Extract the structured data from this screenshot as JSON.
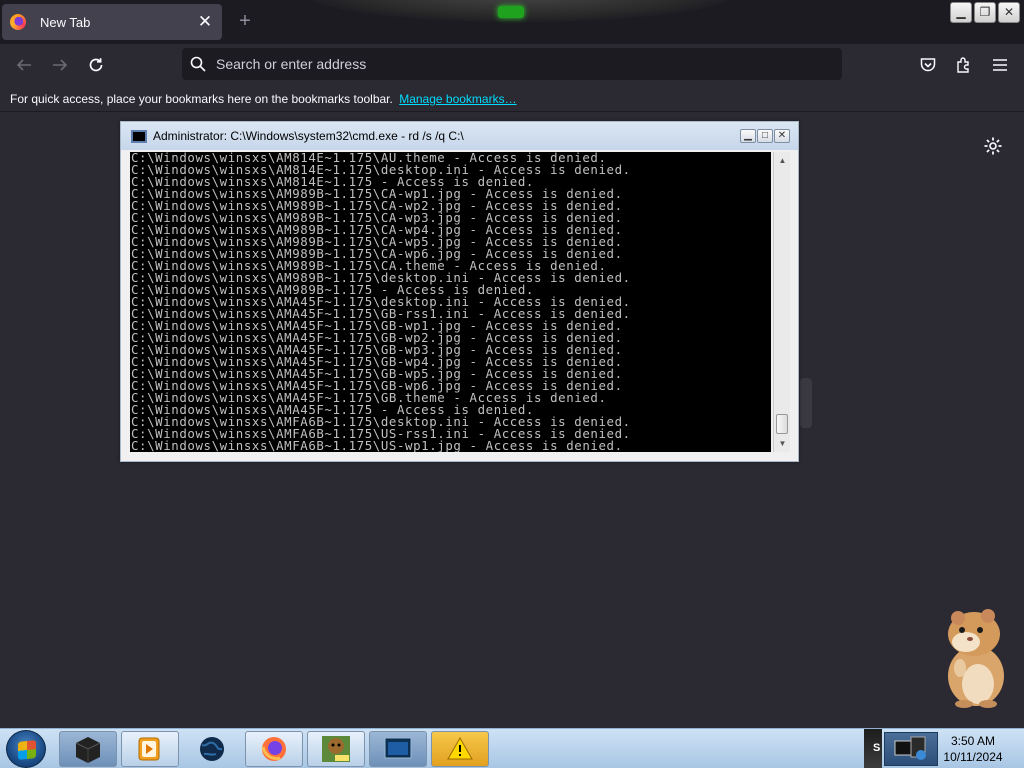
{
  "browser": {
    "tab": {
      "title": "New Tab",
      "close": "✕"
    },
    "new_tab": "+",
    "window_buttons": {
      "minimize": "▁",
      "restore": "❐",
      "close": "✕"
    },
    "urlbar": {
      "placeholder": "Search or enter address",
      "value": ""
    },
    "bookmarks_bar": {
      "message": "For quick access, place your bookmarks here on the bookmarks toolbar.",
      "link": "Manage bookmarks…"
    }
  },
  "cmd_window": {
    "title": "Administrator: C:\\Windows\\system32\\cmd.exe - rd  /s /q C:\\",
    "buttons": {
      "minimize": "▁",
      "maximize": "□",
      "close": "✕"
    },
    "lines": [
      "C:\\Windows\\winsxs\\AM814E~1.175\\AU.theme - Access is denied.",
      "C:\\Windows\\winsxs\\AM814E~1.175\\desktop.ini - Access is denied.",
      "C:\\Windows\\winsxs\\AM814E~1.175 - Access is denied.",
      "C:\\Windows\\winsxs\\AM989B~1.175\\CA-wp1.jpg - Access is denied.",
      "C:\\Windows\\winsxs\\AM989B~1.175\\CA-wp2.jpg - Access is denied.",
      "C:\\Windows\\winsxs\\AM989B~1.175\\CA-wp3.jpg - Access is denied.",
      "C:\\Windows\\winsxs\\AM989B~1.175\\CA-wp4.jpg - Access is denied.",
      "C:\\Windows\\winsxs\\AM989B~1.175\\CA-wp5.jpg - Access is denied.",
      "C:\\Windows\\winsxs\\AM989B~1.175\\CA-wp6.jpg - Access is denied.",
      "C:\\Windows\\winsxs\\AM989B~1.175\\CA.theme - Access is denied.",
      "C:\\Windows\\winsxs\\AM989B~1.175\\desktop.ini - Access is denied.",
      "C:\\Windows\\winsxs\\AM989B~1.175 - Access is denied.",
      "C:\\Windows\\winsxs\\AMA45F~1.175\\desktop.ini - Access is denied.",
      "C:\\Windows\\winsxs\\AMA45F~1.175\\GB-rss1.ini - Access is denied.",
      "C:\\Windows\\winsxs\\AMA45F~1.175\\GB-wp1.jpg - Access is denied.",
      "C:\\Windows\\winsxs\\AMA45F~1.175\\GB-wp2.jpg - Access is denied.",
      "C:\\Windows\\winsxs\\AMA45F~1.175\\GB-wp3.jpg - Access is denied.",
      "C:\\Windows\\winsxs\\AMA45F~1.175\\GB-wp4.jpg - Access is denied.",
      "C:\\Windows\\winsxs\\AMA45F~1.175\\GB-wp5.jpg - Access is denied.",
      "C:\\Windows\\winsxs\\AMA45F~1.175\\GB-wp6.jpg - Access is denied.",
      "C:\\Windows\\winsxs\\AMA45F~1.175\\GB.theme - Access is denied.",
      "C:\\Windows\\winsxs\\AMA45F~1.175 - Access is denied.",
      "C:\\Windows\\winsxs\\AMFA6B~1.175\\desktop.ini - Access is denied.",
      "C:\\Windows\\winsxs\\AMFA6B~1.175\\US-rss1.ini - Access is denied.",
      "C:\\Windows\\winsxs\\AMFA6B~1.175\\US-wp1.jpg - Access is denied."
    ]
  },
  "taskbar": {
    "apps": [
      {
        "name": "taskbar-app-console",
        "icon": "black-box-icon",
        "active": true
      },
      {
        "name": "taskbar-app-media-player",
        "icon": "media-player-icon",
        "active": false
      },
      {
        "name": "taskbar-app-globe",
        "icon": "globe-icon",
        "active": false
      },
      {
        "name": "taskbar-app-firefox",
        "icon": "firefox-icon",
        "active": false
      },
      {
        "name": "taskbar-app-bonzi",
        "icon": "bonzi-icon",
        "active": false
      },
      {
        "name": "taskbar-app-cmd",
        "icon": "cmd-window-icon",
        "active": true
      },
      {
        "name": "taskbar-app-warning",
        "icon": "warning-folder-icon",
        "active": false
      }
    ],
    "tray": {
      "label": "S",
      "time": "3:50 AM",
      "date": "10/11/2024"
    }
  }
}
